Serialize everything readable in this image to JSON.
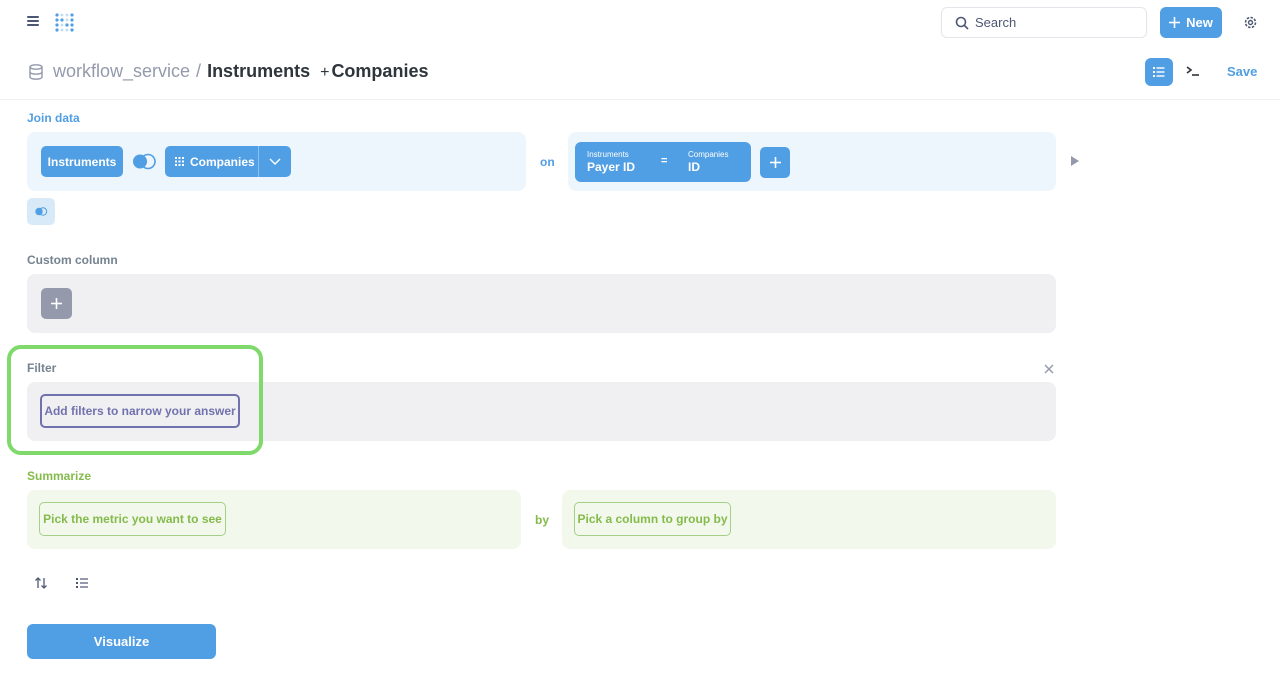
{
  "topbar": {
    "search_label": "Search",
    "new_label": "New"
  },
  "header": {
    "database": "workflow_service",
    "separator": "/",
    "table": "Instruments",
    "join_plus": "+",
    "joined_table": "Companies",
    "save_label": "Save"
  },
  "join": {
    "label": "Join data",
    "left_table": "Instruments",
    "right_table": "Companies",
    "on_label": "on",
    "condition": {
      "left_table": "Instruments",
      "left_column": "Payer ID",
      "operator": "=",
      "right_table": "Companies",
      "right_column": "ID"
    }
  },
  "custom_column": {
    "label": "Custom column"
  },
  "filter": {
    "label": "Filter",
    "placeholder": "Add filters to narrow your answer"
  },
  "summarize": {
    "label": "Summarize",
    "metric_placeholder": "Pick the metric you want to see",
    "by_label": "by",
    "group_placeholder": "Pick a column to group by"
  },
  "visualize_label": "Visualize",
  "colors": {
    "brand": "#509ee3",
    "filter": "#7172ad",
    "summarize": "#84bb4c",
    "highlight": "#7fd96b"
  }
}
